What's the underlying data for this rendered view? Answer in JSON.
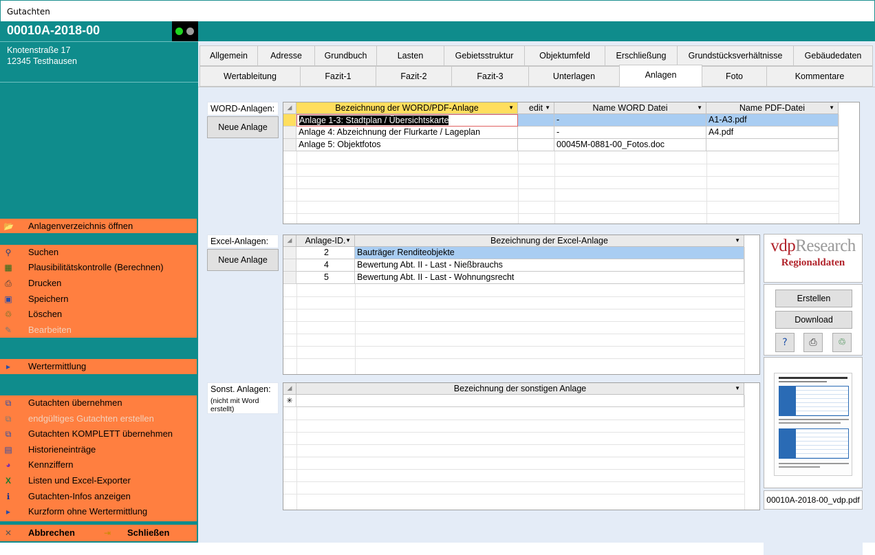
{
  "window": {
    "title": "Gutachten"
  },
  "record": {
    "id": "00010A-2018-00",
    "street": "Knotenstraße 17",
    "city": "12345 Testhausen"
  },
  "menu": {
    "open_annex": "Anlagenverzeichnis öffnen",
    "search": "Suchen",
    "plausibility": "Plausibilitätskontrolle (Berechnen)",
    "print": "Drucken",
    "save": "Speichern",
    "delete": "Löschen",
    "edit": "Bearbeiten",
    "valuation": "Wertermittlung",
    "take_report": "Gutachten übernehmen",
    "final_report": "endgültiges Gutachten erstellen",
    "take_complete": "Gutachten KOMPLETT übernehmen",
    "history": "Historieneinträge",
    "indicators": "Kennziffern",
    "lists_export": "Listen und Excel-Exporter",
    "report_info": "Gutachten-Infos anzeigen",
    "short_form": "Kurzform ohne Wertermittlung",
    "cancel": "Abbrechen",
    "close": "Schließen"
  },
  "tabs_row1": [
    "Allgemein",
    "Adresse",
    "Grundbuch",
    "Lasten",
    "Gebietsstruktur",
    "Objektumfeld",
    "Erschließung",
    "Grundstücksverhältnisse",
    "Gebäudedaten"
  ],
  "tabs_row2": [
    "Wertableitung",
    "Fazit-1",
    "Fazit-2",
    "Fazit-3",
    "Unterlagen",
    "Anlagen",
    "Foto",
    "Kommentare"
  ],
  "word": {
    "label": "WORD-Anlagen:",
    "new_button": "Neue Anlage",
    "headers": [
      "Bezeichnung der WORD/PDF-Anlage",
      "edit",
      "Name WORD Datei",
      "Name PDF-Datei"
    ],
    "rows": [
      [
        "Anlage 1-3: Stadtplan / Übersichtskarte",
        "",
        "-",
        "A1-A3.pdf"
      ],
      [
        "Anlage 4: Abzeichnung der Flurkarte / Lageplan",
        "",
        "-",
        "A4.pdf"
      ],
      [
        "Anlage 5: Objektfotos",
        "",
        "00045M-0881-00_Fotos.doc",
        ""
      ]
    ]
  },
  "excel": {
    "label": "Excel-Anlagen:",
    "new_button": "Neue Anlage",
    "headers": [
      "Anlage-ID.",
      "Bezeichnung der Excel-Anlage"
    ],
    "rows": [
      [
        "2",
        "Bauträger Renditeobjekte"
      ],
      [
        "4",
        "Bewertung Abt. II - Last - Nießbrauchs"
      ],
      [
        "5",
        "Bewertung Abt. II - Last - Wohnungsrecht"
      ]
    ]
  },
  "other": {
    "label": "Sonst. Anlagen:",
    "note": "(nicht mit Word erstellt)",
    "headers": [
      "Bezeichnung der sonstigen Anlage"
    ],
    "new_row_marker": "✳"
  },
  "vdp": {
    "logo_prefix": "vdp",
    "logo_suffix": "Research",
    "subtitle": "Regionaldaten",
    "create_button": "Erstellen",
    "download_button": "Download",
    "filename": "00010A-2018-00_vdp.pdf"
  },
  "colors": {
    "teal": "#0f8c8c",
    "orange": "#ff7f40",
    "panel": "#e4ecf7",
    "vdp_red": "#b1232b"
  }
}
